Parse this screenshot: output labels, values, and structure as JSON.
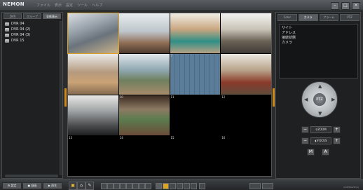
{
  "app": {
    "title": "NEMON",
    "menu": [
      "ファイル",
      "表示",
      "設定",
      "ツール",
      "ヘルプ"
    ]
  },
  "left_panel": {
    "tabs": [
      "DVR",
      "グループ",
      "全体表示"
    ],
    "tree": [
      {
        "label": "DVR 04"
      },
      {
        "label": "DVR 04 (2)"
      },
      {
        "label": "DVR 04 (3)"
      },
      {
        "label": "DVR 15"
      }
    ]
  },
  "grid": {
    "cells": [
      {
        "num": "1",
        "scene": "cam1"
      },
      {
        "num": "2",
        "scene": "cam2"
      },
      {
        "num": "3",
        "scene": "cam3"
      },
      {
        "num": "4",
        "scene": "cam4"
      },
      {
        "num": "5",
        "scene": "cam5"
      },
      {
        "num": "6",
        "scene": "cam6"
      },
      {
        "num": "7",
        "scene": "cam7"
      },
      {
        "num": "8",
        "scene": "cam8"
      },
      {
        "num": "9",
        "scene": "cam9"
      },
      {
        "num": "10",
        "scene": "cam10"
      },
      {
        "num": "11",
        "scene": ""
      },
      {
        "num": "12",
        "scene": ""
      },
      {
        "num": "13",
        "scene": ""
      },
      {
        "num": "14",
        "scene": ""
      },
      {
        "num": "15",
        "scene": ""
      },
      {
        "num": "16",
        "scene": ""
      }
    ]
  },
  "right_panel": {
    "tabs": [
      "Color",
      "カメラ",
      "アラーム",
      "PTZ"
    ],
    "info": [
      "サイト",
      "アドレス",
      "接続状態",
      "カメラ"
    ],
    "ptz_label": "PTZ",
    "zoom_label": "ZOOM",
    "focus_label": "FOCUS",
    "zoom_minus": "−",
    "zoom_plus": "+",
    "focus_minus": "−",
    "focus_plus": "+",
    "iris_a": "M",
    "iris_b": "A"
  },
  "bottom": {
    "buttons": [
      "設定",
      "録画",
      "再生"
    ],
    "layouts": [
      "1",
      "4",
      "6",
      "8",
      "9",
      "10",
      "13",
      "16"
    ],
    "copyright": "COPYRIGHT(C)"
  }
}
